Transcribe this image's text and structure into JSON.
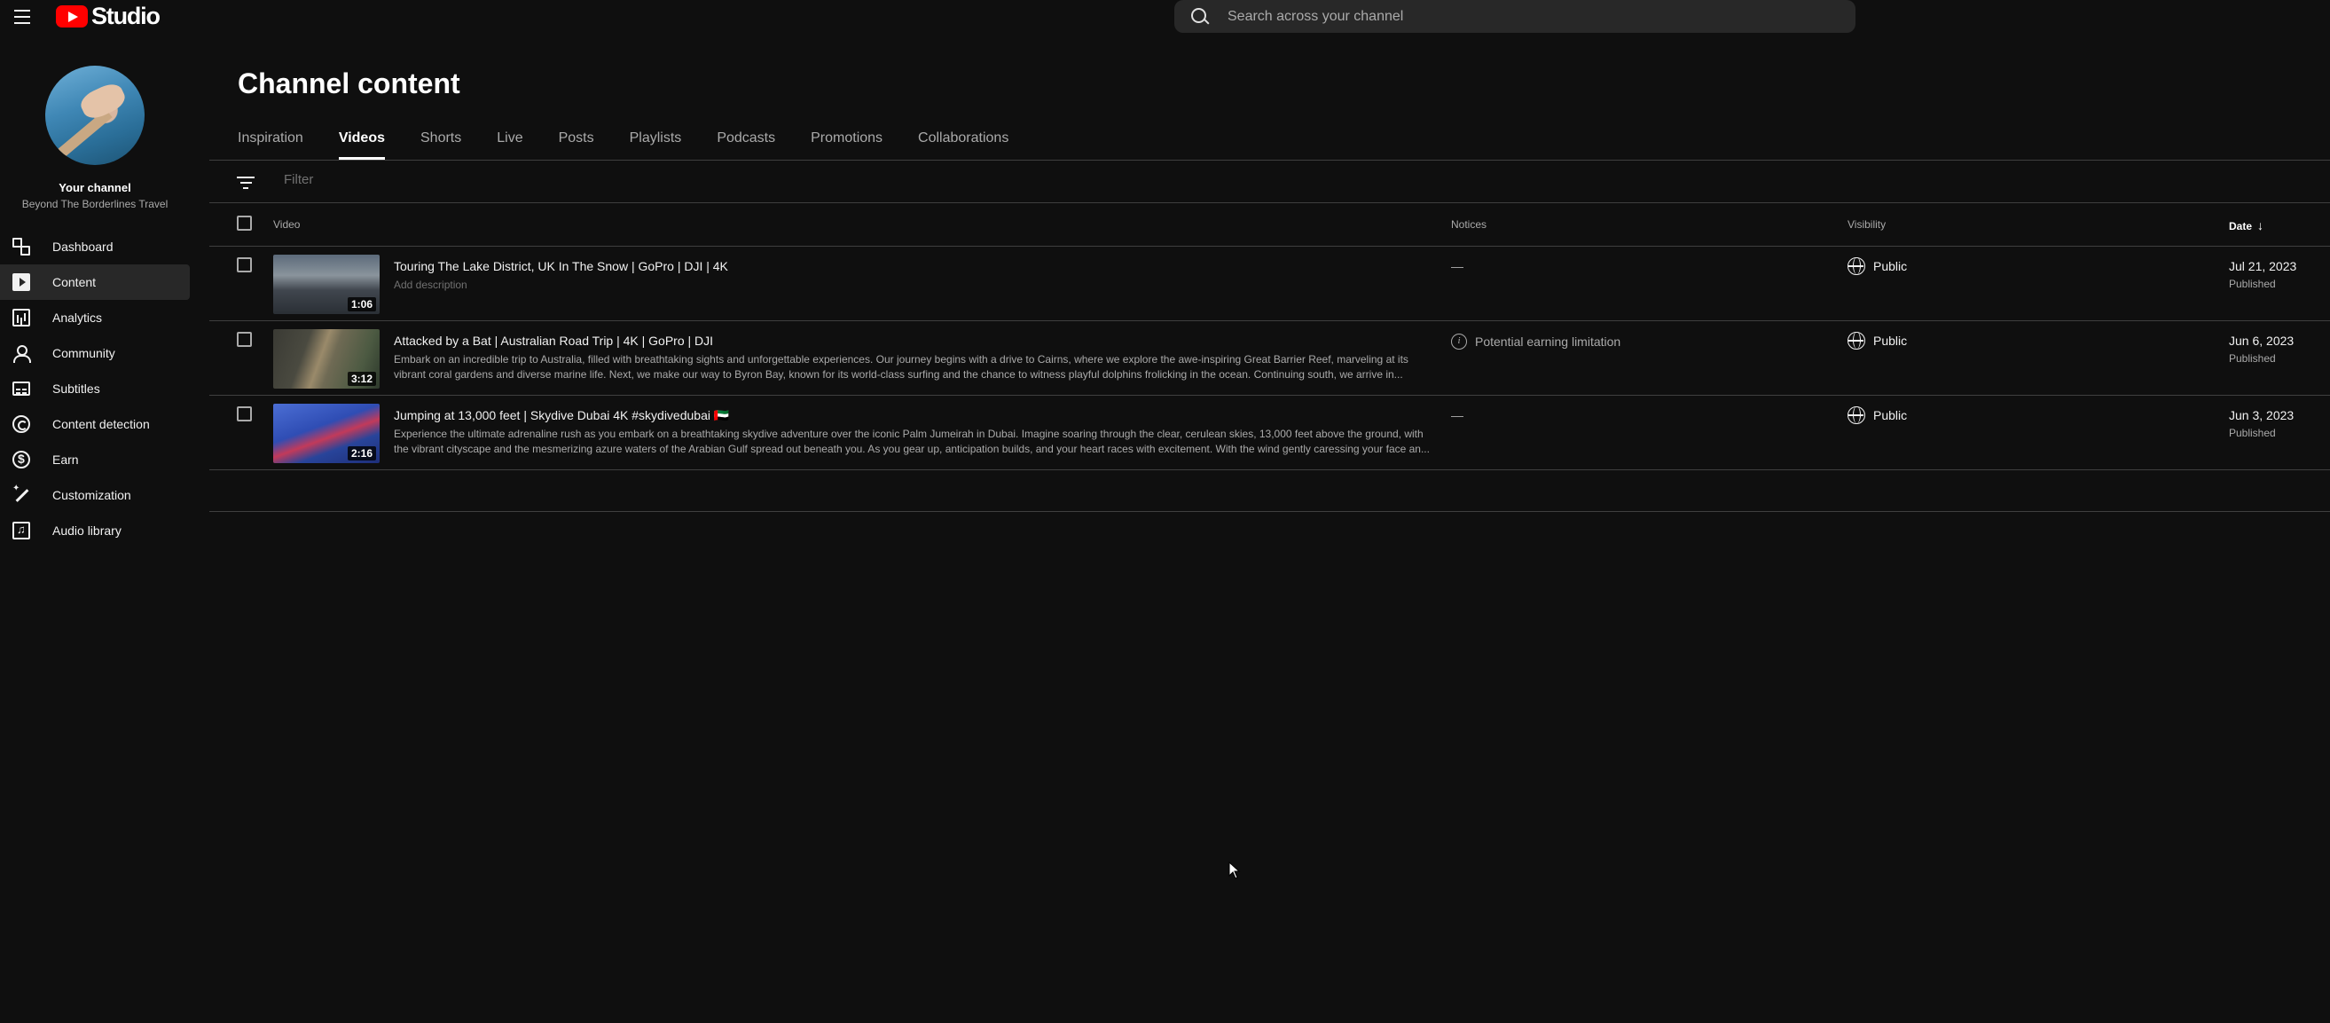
{
  "app": {
    "logo_text": "Studio"
  },
  "search": {
    "placeholder": "Search across your channel"
  },
  "channel": {
    "label": "Your channel",
    "name": "Beyond The Borderlines Travel"
  },
  "sidebar": {
    "items": [
      {
        "label": "Dashboard",
        "icon": "dashboard-icon"
      },
      {
        "label": "Content",
        "icon": "content-icon",
        "active": true
      },
      {
        "label": "Analytics",
        "icon": "analytics-icon"
      },
      {
        "label": "Community",
        "icon": "community-icon"
      },
      {
        "label": "Subtitles",
        "icon": "subtitles-icon"
      },
      {
        "label": "Content detection",
        "icon": "content-detection-icon"
      },
      {
        "label": "Earn",
        "icon": "earn-icon"
      },
      {
        "label": "Customization",
        "icon": "customization-icon"
      },
      {
        "label": "Audio library",
        "icon": "audio-library-icon"
      }
    ]
  },
  "main": {
    "title": "Channel content",
    "tabs": [
      {
        "label": "Inspiration"
      },
      {
        "label": "Videos",
        "active": true
      },
      {
        "label": "Shorts"
      },
      {
        "label": "Live"
      },
      {
        "label": "Posts"
      },
      {
        "label": "Playlists"
      },
      {
        "label": "Podcasts"
      },
      {
        "label": "Promotions"
      },
      {
        "label": "Collaborations"
      }
    ],
    "filter": {
      "placeholder": "Filter"
    },
    "columns": {
      "video": "Video",
      "notices": "Notices",
      "visibility": "Visibility",
      "date": "Date"
    }
  },
  "videos": [
    {
      "title": "Touring The Lake District, UK In The Snow | GoPro | DJI | 4K",
      "description": "Add description",
      "duration": "1:06",
      "notice": "—",
      "visibility": "Public",
      "date": "Jul 21, 2023",
      "status": "Published"
    },
    {
      "title": "Attacked by a Bat | Australian Road Trip | 4K | GoPro | DJI",
      "description": "Embark on an incredible trip to Australia, filled with breathtaking sights and unforgettable experiences. Our journey begins with a drive to Cairns, where we explore the awe-inspiring Great Barrier Reef, marveling at its vibrant coral gardens and diverse marine life. Next, we make our way to Byron Bay, known for its world-class surfing and the chance to witness playful dolphins frolicking in the ocean. Continuing south, we arrive in...",
      "duration": "3:12",
      "notice": "Potential earning limitation",
      "visibility": "Public",
      "date": "Jun 6, 2023",
      "status": "Published"
    },
    {
      "title": "Jumping at 13,000 feet | Skydive Dubai 4K #skydivedubai 🇦🇪",
      "description": "Experience the ultimate adrenaline rush as you embark on a breathtaking skydive adventure over the iconic Palm Jumeirah in Dubai. Imagine soaring through the clear, cerulean skies, 13,000 feet above the ground, with the vibrant cityscape and the mesmerizing azure waters of the Arabian Gulf spread out beneath you. As you gear up, anticipation builds, and your heart races with excitement. With the wind gently caressing your face an...",
      "duration": "2:16",
      "notice": "—",
      "visibility": "Public",
      "date": "Jun 3, 2023",
      "status": "Published"
    }
  ]
}
